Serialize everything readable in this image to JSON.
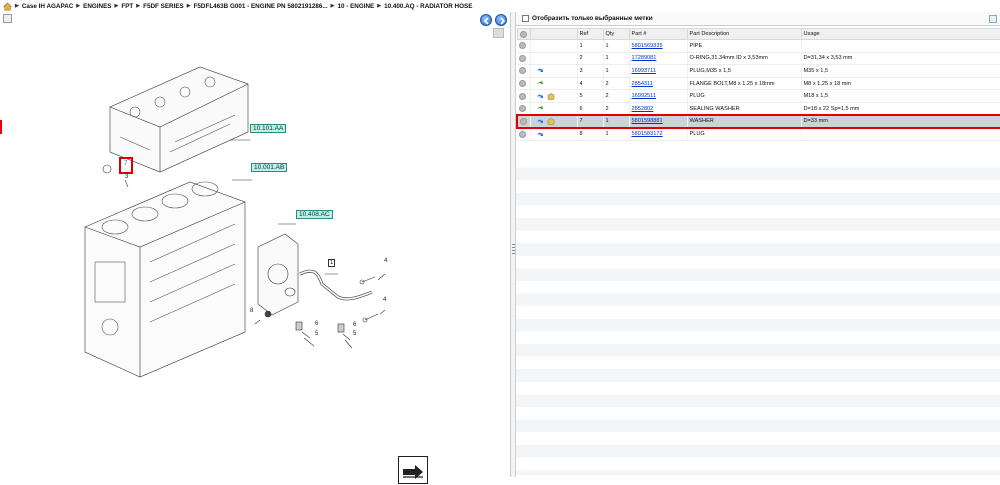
{
  "breadcrumb": [
    "Case IH AGAPAC",
    "ENGINES",
    "FPT",
    "F5DF SERIES",
    "F5DFL463B G001 - ENGINE PN 5802191286...",
    "10 - ENGINE",
    "10.400.AQ - RADIATOR HOSE"
  ],
  "diagram": {
    "callouts": [
      "10.101.AA",
      "10.001.AB",
      "10.408.AC"
    ],
    "ref_labels": [
      "3",
      "1",
      "4",
      "4",
      "8",
      "6",
      "5",
      "6",
      "5"
    ],
    "selected_ref": "7"
  },
  "filter": {
    "label": "Отобразить только выбранные метки",
    "checked": false
  },
  "table": {
    "columns": [
      "",
      "",
      "Ref",
      "Qty",
      "Part #",
      "Part Description",
      "Usage"
    ],
    "rows": [
      {
        "ref": "1",
        "qty": "1",
        "part": "5801569335",
        "desc": "PIPE",
        "usage": "",
        "icons": [],
        "selected": false
      },
      {
        "ref": "2",
        "qty": "1",
        "part": "17289081",
        "desc": "O-RING,31.34mm ID x 3,53mm",
        "usage": "D=31,34 x 3,53 mm",
        "icons": [],
        "selected": false
      },
      {
        "ref": "3",
        "qty": "1",
        "part": "16993711",
        "desc": "PLUG,M35 x 1,5",
        "usage": "M35 x 1,5",
        "icons": [
          "blue-arrow-icon"
        ],
        "selected": false
      },
      {
        "ref": "4",
        "qty": "2",
        "part": "2854311",
        "desc": "FLANGE BOLT,M8 x 1.25 x 18mm",
        "usage": "M8 x 1,25 x 18 mm",
        "icons": [
          "green-arrow-icon"
        ],
        "selected": false
      },
      {
        "ref": "5",
        "qty": "2",
        "part": "16992511",
        "desc": "PLUG",
        "usage": "M18 x 1,5",
        "icons": [
          "blue-arrow-icon",
          "package-icon"
        ],
        "selected": false
      },
      {
        "ref": "6",
        "qty": "2",
        "part": "2852802",
        "desc": "SEALING WASHER",
        "usage": "D=18 x 22 Sp=1,5 mm",
        "icons": [
          "green-arrow-icon"
        ],
        "selected": false
      },
      {
        "ref": "7",
        "qty": "1",
        "part": "5801598881",
        "desc": "WASHER",
        "usage": "D=33 mm",
        "icons": [
          "blue-arrow-icon",
          "package-icon"
        ],
        "selected": true
      },
      {
        "ref": "8",
        "qty": "1",
        "part": "5801583172",
        "desc": "PLUG",
        "usage": "",
        "icons": [
          "blue-arrow-icon"
        ],
        "selected": false
      }
    ]
  },
  "colors": {
    "accent_blue": "#2f6fd0",
    "selection_red": "#dd0000",
    "callout_bg": "#bff0e6",
    "link_blue": "#0033cc"
  }
}
